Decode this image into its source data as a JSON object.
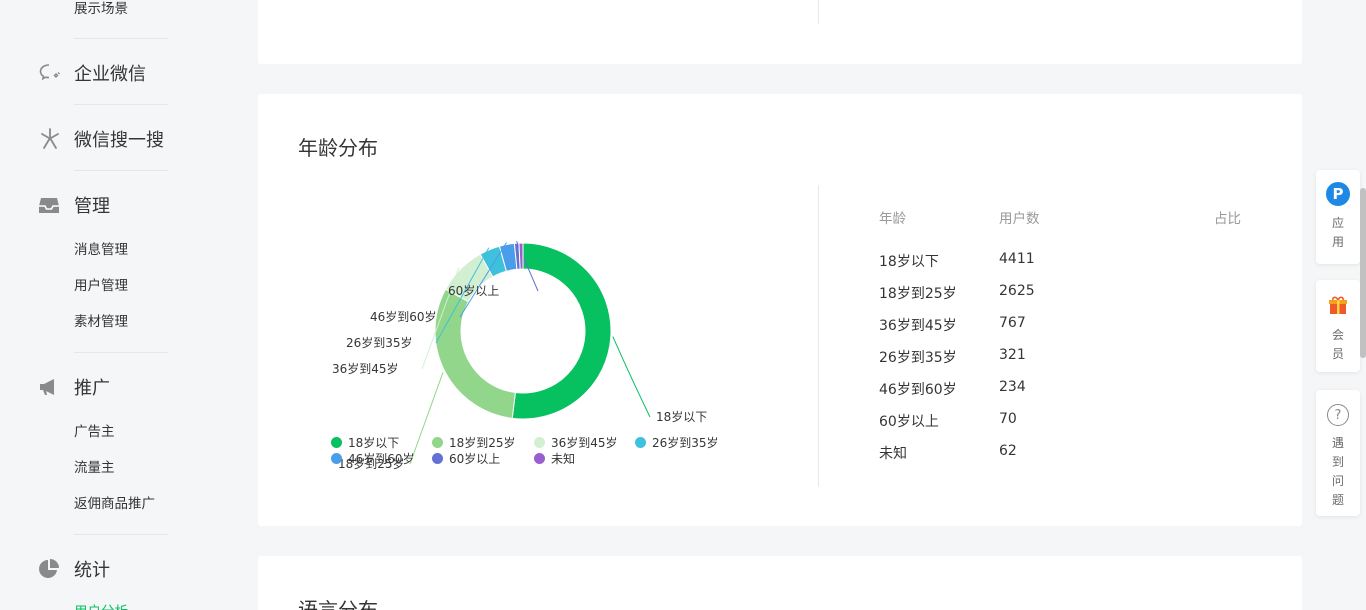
{
  "sidebar": {
    "top_item": "展示场景",
    "groups": [
      {
        "label": "企业微信",
        "icon": "chat-bubble-icon"
      },
      {
        "label": "微信搜一搜",
        "icon": "search-sparkle-icon"
      },
      {
        "label": "管理",
        "icon": "inbox-icon"
      },
      {
        "label": "推广",
        "icon": "megaphone-icon"
      },
      {
        "label": "统计",
        "icon": "pie-chart-icon"
      }
    ],
    "manage_items": [
      "消息管理",
      "用户管理",
      "素材管理"
    ],
    "promo_items": [
      "广告主",
      "流量主",
      "返佣商品推广"
    ],
    "stats_items": [
      "用户分析"
    ]
  },
  "age_card": {
    "title": "年龄分布",
    "table": {
      "headers": [
        "年龄",
        "用户数",
        "占比"
      ],
      "rows": [
        {
          "age": "18岁以下",
          "count": "4411"
        },
        {
          "age": "18岁到25岁",
          "count": "2625"
        },
        {
          "age": "36岁到45岁",
          "count": "767"
        },
        {
          "age": "26岁到35岁",
          "count": "321"
        },
        {
          "age": "46岁到60岁",
          "count": "234"
        },
        {
          "age": "60岁以上",
          "count": "70"
        },
        {
          "age": "未知",
          "count": "62"
        }
      ]
    }
  },
  "lang_card": {
    "title": "语言分布"
  },
  "float_panel": {
    "app": {
      "badge": "P",
      "text": "应用"
    },
    "member": {
      "text": "会员"
    },
    "help": {
      "badge": "?",
      "text": "遇到问题"
    }
  },
  "chart_data": {
    "type": "pie",
    "donut": true,
    "categories": [
      "18岁以下",
      "18岁到25岁",
      "36岁到45岁",
      "26岁到35岁",
      "46岁到60岁",
      "60岁以上",
      "未知"
    ],
    "values": [
      4411,
      2625,
      767,
      321,
      234,
      70,
      62
    ],
    "colors": [
      "#07c160",
      "#91d68a",
      "#d3efd2",
      "#3fc1dd",
      "#4a9de8",
      "#6370d4",
      "#9a5fcf"
    ],
    "legend": [
      "18岁以下",
      "18岁到25岁",
      "36岁到45岁",
      "26岁到35岁",
      "46岁到60岁",
      "60岁以上",
      "未知"
    ],
    "legend_placement": "bottom"
  }
}
